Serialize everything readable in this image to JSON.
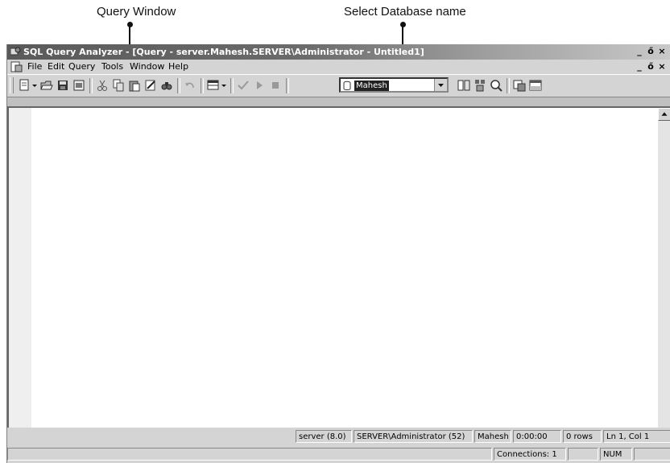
{
  "annotations": {
    "query_window": "Query Window",
    "select_database": "Select Database name"
  },
  "titlebar": {
    "title": "SQL Query Analyzer - [Query - server.Mahesh.SERVER\\Administrator - Untitled1]",
    "controls": [
      "_",
      "ő",
      "×"
    ]
  },
  "menubar": {
    "items": [
      "File",
      "Edit",
      "Query",
      "Tools",
      "Window",
      "Help"
    ],
    "mdi_controls": [
      "_",
      "ő",
      "×"
    ]
  },
  "toolbar": {
    "database_value": "Mahesh"
  },
  "statusbar": {
    "server": "server (8.0)",
    "user": "SERVER\\Administrator (52)",
    "database": "Mahesh",
    "time": "0:00:00",
    "rows": "0 rows",
    "position": "Ln 1, Col 1",
    "connections": "Connections: 1",
    "num": "NUM"
  },
  "colors": {
    "titlebar_start": "#5a5a5a",
    "titlebar_end": "#c9c9c9",
    "chrome": "#d4d4d4",
    "editor_bg": "#ffffff"
  }
}
